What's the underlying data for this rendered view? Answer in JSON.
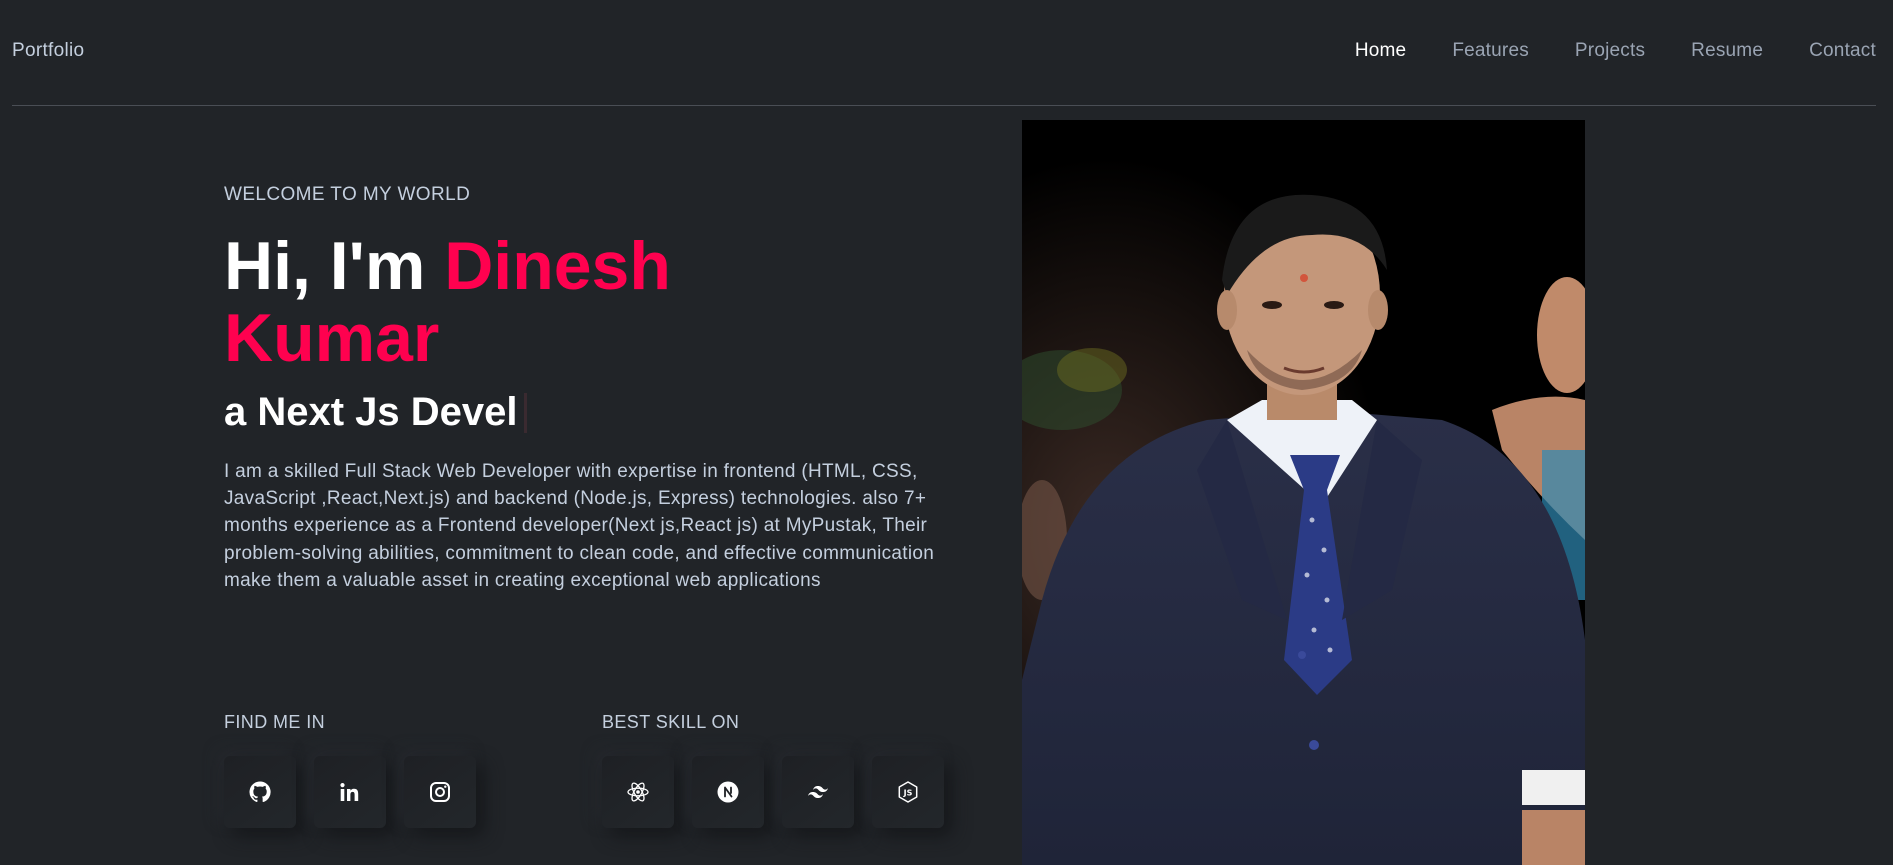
{
  "header": {
    "brand": "Portfolio",
    "nav": [
      {
        "label": "Home",
        "active": true
      },
      {
        "label": "Features",
        "active": false
      },
      {
        "label": "Projects",
        "active": false
      },
      {
        "label": "Resume",
        "active": false
      },
      {
        "label": "Contact",
        "active": false
      }
    ]
  },
  "hero": {
    "welcome": "WELCOME TO MY WORLD",
    "greeting": "Hi, I'm ",
    "name_first": "Dinesh",
    "name_last": "Kumar",
    "typed_text": "a Next Js Devel",
    "intro": "I am a skilled Full Stack Web Developer with expertise in frontend (HTML, CSS, JavaScript ,React,Next.js) and backend (Node.js, Express) technologies. also 7+ months experience as a Frontend developer(Next js,React js) at MyPustak, Their problem-solving abilities, commitment to clean code, and effective communication make them a valuable asset in creating exceptional web applications"
  },
  "find_me": {
    "label": "FIND ME IN",
    "icons": [
      "github-icon",
      "linkedin-icon",
      "instagram-icon"
    ]
  },
  "skills": {
    "label": "BEST SKILL ON",
    "icons": [
      "react-icon",
      "nextjs-icon",
      "tailwind-icon",
      "nodejs-icon"
    ]
  },
  "colors": {
    "background": "#212428",
    "accent": "#ff014f",
    "text": "#c4cfde",
    "heading": "#ffffff"
  }
}
